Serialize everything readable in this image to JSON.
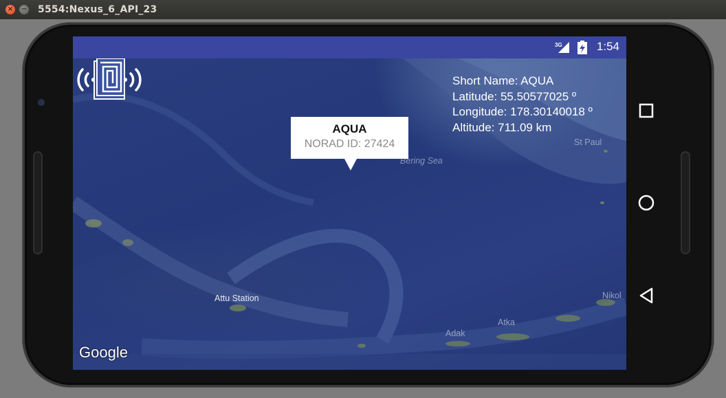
{
  "window": {
    "title": "5554:Nexus_6_API_23",
    "close_label": "×",
    "minimize_label": "−"
  },
  "status_bar": {
    "network": "3G",
    "time": "1:54"
  },
  "satellite_info": {
    "short_name": "Short Name: AQUA",
    "latitude": "Latitude: 55.50577025 º",
    "longitude": "Longitude: 178.30140018 º",
    "altitude": "Altitude: 711.09 km"
  },
  "marker": {
    "title": "AQUA",
    "subtitle": "NORAD ID: 27424",
    "icon": "satellite-icon"
  },
  "map_labels": {
    "bering_sea": "Bering Sea",
    "st_paul": "St Paul",
    "attu_station": "Attu Station",
    "adak": "Adak",
    "atka": "Atka",
    "nikolski": "Nikol",
    "google": "Google"
  },
  "nav": {
    "back": "back-icon",
    "home": "home-icon",
    "recents": "recents-icon"
  },
  "colors": {
    "status_bar": "#3a46a0",
    "ocean": "#2a3d7e",
    "window_bg": "#7c7c7c"
  }
}
